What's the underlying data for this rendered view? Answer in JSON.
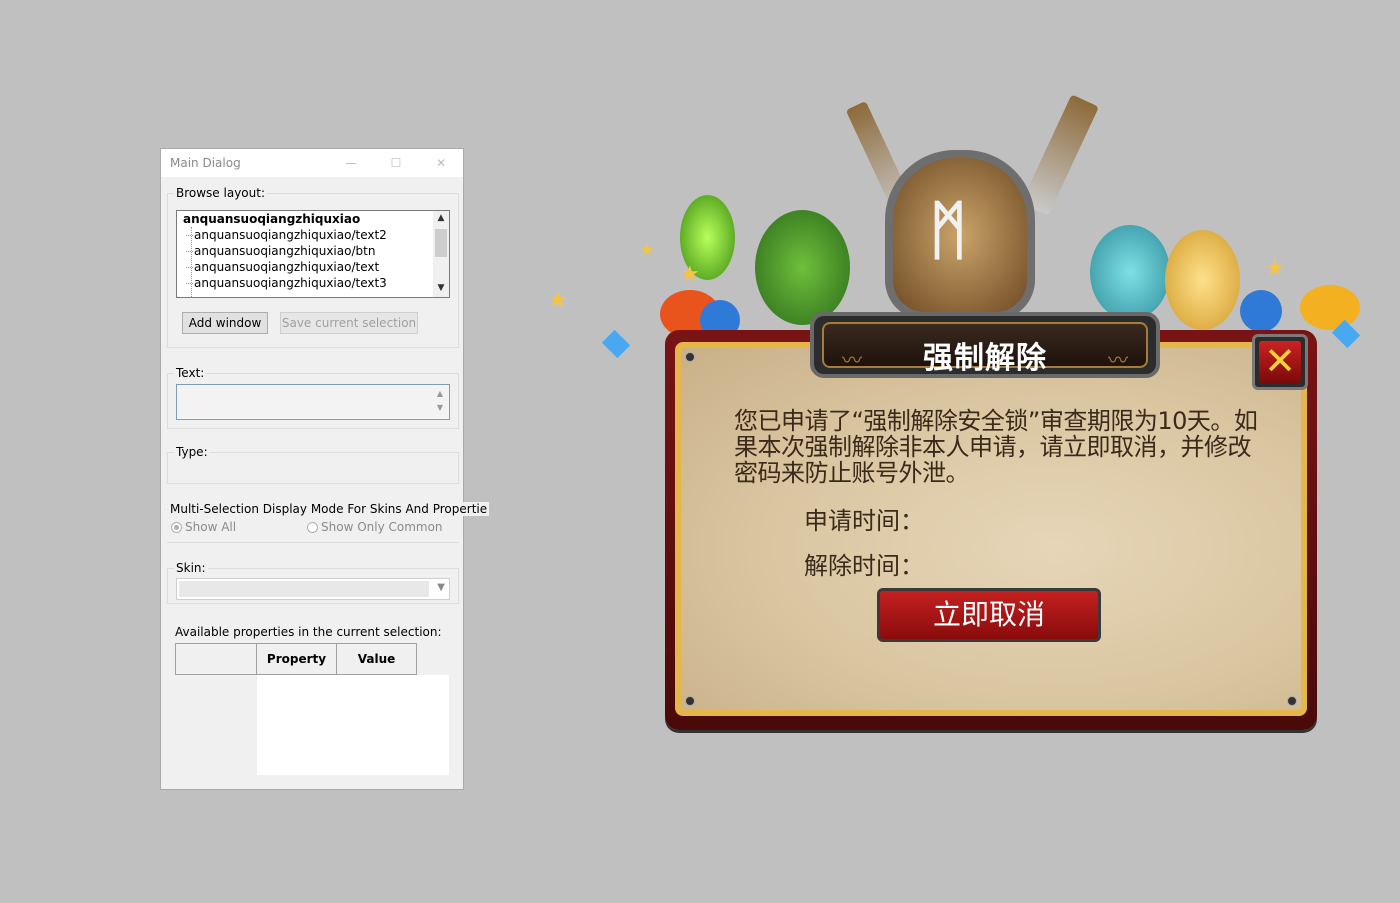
{
  "main_dialog": {
    "title": "Main Dialog",
    "controls": {
      "minimize": "—",
      "maximize": "☐",
      "close": "✕"
    },
    "browse_layout": {
      "label": "Browse layout:",
      "tree": {
        "root": "anquansuoqiangzhiquxiao",
        "children": [
          "anquansuoqiangzhiquxiao/text2",
          "anquansuoqiangzhiquxiao/btn",
          "anquansuoqiangzhiquxiao/text",
          "anquansuoqiangzhiquxiao/text3"
        ]
      },
      "add_window_label": "Add window",
      "save_selection_label": "Save current selection"
    },
    "text_group": {
      "label": "Text:",
      "value": ""
    },
    "type_group": {
      "label": "Type:"
    },
    "multi_selection": {
      "label": "Multi-Selection Display Mode For Skins And Propertie",
      "options": [
        "Show All",
        "Show Only Common"
      ],
      "selected": "Show All"
    },
    "skin_group": {
      "label": "Skin:",
      "value": ""
    },
    "properties": {
      "label": "Available properties in the current selection:",
      "columns": [
        "",
        "Property",
        "Value"
      ]
    }
  },
  "game_popup": {
    "title": "强制解除",
    "message": "您已申请了“强制解除安全锁”审查期限为10天。如果本次强制解除非本人申请，请立即取消，并修改密码来防止账号外泄。",
    "apply_time_label": "申请时间：",
    "release_time_label": "解除时间：",
    "cancel_button_label": "立即取消",
    "close_icon": "close-x-icon",
    "accent_color": "#f4d23a",
    "frame_color": "#7a1414"
  }
}
